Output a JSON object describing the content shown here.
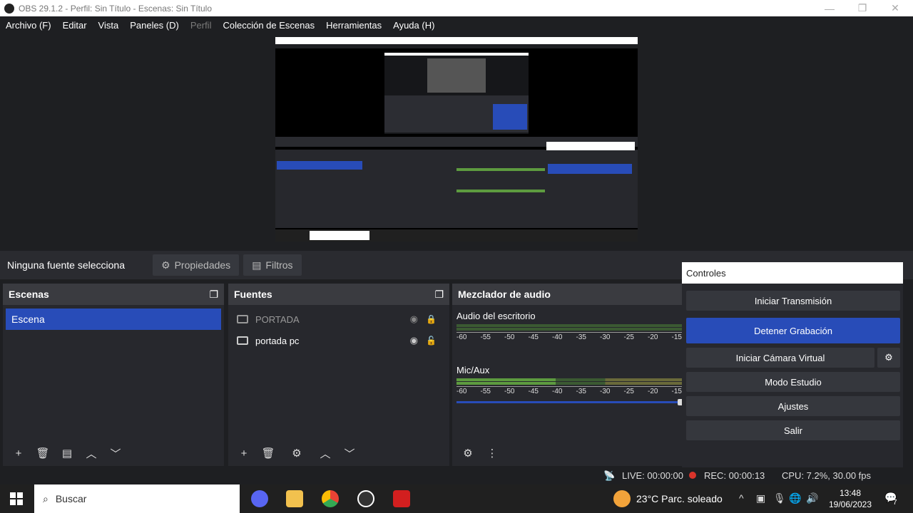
{
  "window": {
    "title": "OBS 29.1.2 - Perfil: Sin Título - Escenas: Sin Título"
  },
  "menu": [
    "Archivo (F)",
    "Editar",
    "Vista",
    "Paneles (D)",
    "Perfil",
    "Colección de Escenas",
    "Herramientas",
    "Ayuda (H)"
  ],
  "context_bar": {
    "no_source": "Ninguna fuente selecciona",
    "properties": "Propiedades",
    "filters": "Filtros"
  },
  "scenes": {
    "title": "Escenas",
    "items": [
      "Escena"
    ]
  },
  "sources": {
    "title": "Fuentes",
    "items": [
      "PORTADA",
      "portada pc"
    ]
  },
  "mixer": {
    "title": "Mezclador de audio",
    "tracks": [
      {
        "name": "Audio del escritorio"
      },
      {
        "name": "Mic/Aux"
      }
    ],
    "scale": [
      "-60",
      "-55",
      "-50",
      "-45",
      "-40",
      "-35",
      "-30",
      "-25",
      "-20",
      "-15"
    ]
  },
  "controls": {
    "title": "Controles",
    "start_stream": "Iniciar Transmisión",
    "stop_recording": "Detener Grabación",
    "start_virtual_cam": "Iniciar Cámara Virtual",
    "studio_mode": "Modo Estudio",
    "settings": "Ajustes",
    "exit": "Salir"
  },
  "status": {
    "live": "LIVE: 00:00:00",
    "rec": "REC: 00:00:13",
    "cpu": "CPU: 7.2%, 30.00 fps"
  },
  "taskbar": {
    "search_placeholder": "Buscar",
    "weather": "23°C  Parc. soleado",
    "time": "13:48",
    "date": "19/06/2023",
    "notifications": "7"
  },
  "colors": {
    "accent": "#284cb8",
    "record": "#d9342b"
  }
}
